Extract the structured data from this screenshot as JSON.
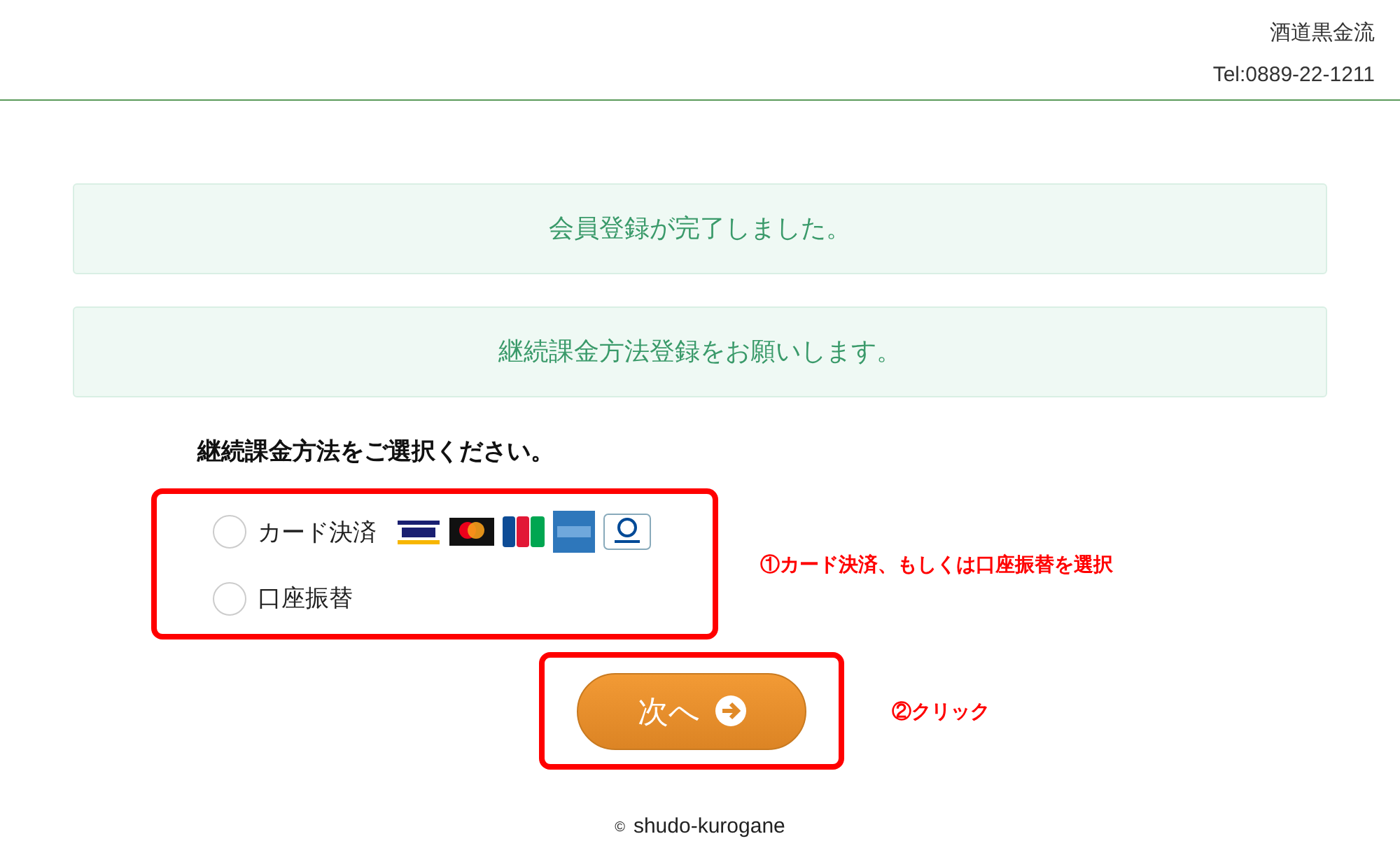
{
  "header": {
    "shop_name": "酒道黒金流",
    "tel": "Tel:0889-22-1211"
  },
  "notices": [
    "会員登録が完了しました。",
    "継続課金方法登録をお願いします。"
  ],
  "heading": "継続課金方法をご選択ください。",
  "options": [
    {
      "label": "カード決済",
      "selected": false,
      "kind": "card"
    },
    {
      "label": "口座振替",
      "selected": false,
      "kind": "plain"
    }
  ],
  "annotations": {
    "options": "①カード決済、もしくは口座振替を選択",
    "button": "②クリック"
  },
  "next_button": "次へ",
  "footer": {
    "copyright_mark": "©",
    "name": "shudo-kurogane"
  }
}
